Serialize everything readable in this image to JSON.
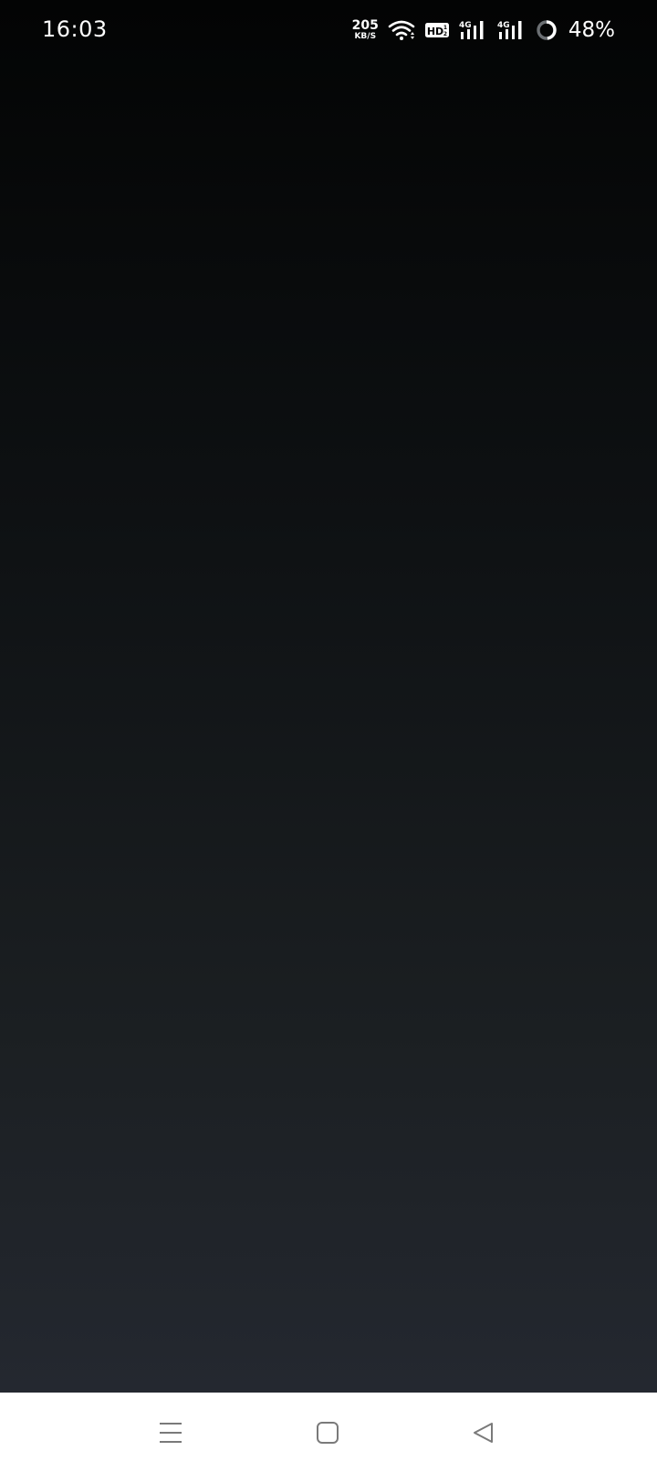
{
  "status_bar": {
    "time": "16:03",
    "net_speed_value": "205",
    "net_speed_unit": "KB/S",
    "hd_badge": "HD",
    "network_1": "4G",
    "network_2": "4G",
    "battery_percent": "48%",
    "battery_level": 0.48,
    "icons": [
      "wifi-icon",
      "hd-voice-icon",
      "signal-4g-icon",
      "signal-4g-icon",
      "battery-ring-icon"
    ]
  },
  "nav_bar": {
    "icons": [
      "menu-icon",
      "home-icon",
      "back-icon"
    ]
  },
  "colors": {
    "background_top": "#030404",
    "background_bottom": "#262a33",
    "nav_background": "#ffffff",
    "nav_icon": "#7a7a7a",
    "status_text": "#ffffff"
  }
}
